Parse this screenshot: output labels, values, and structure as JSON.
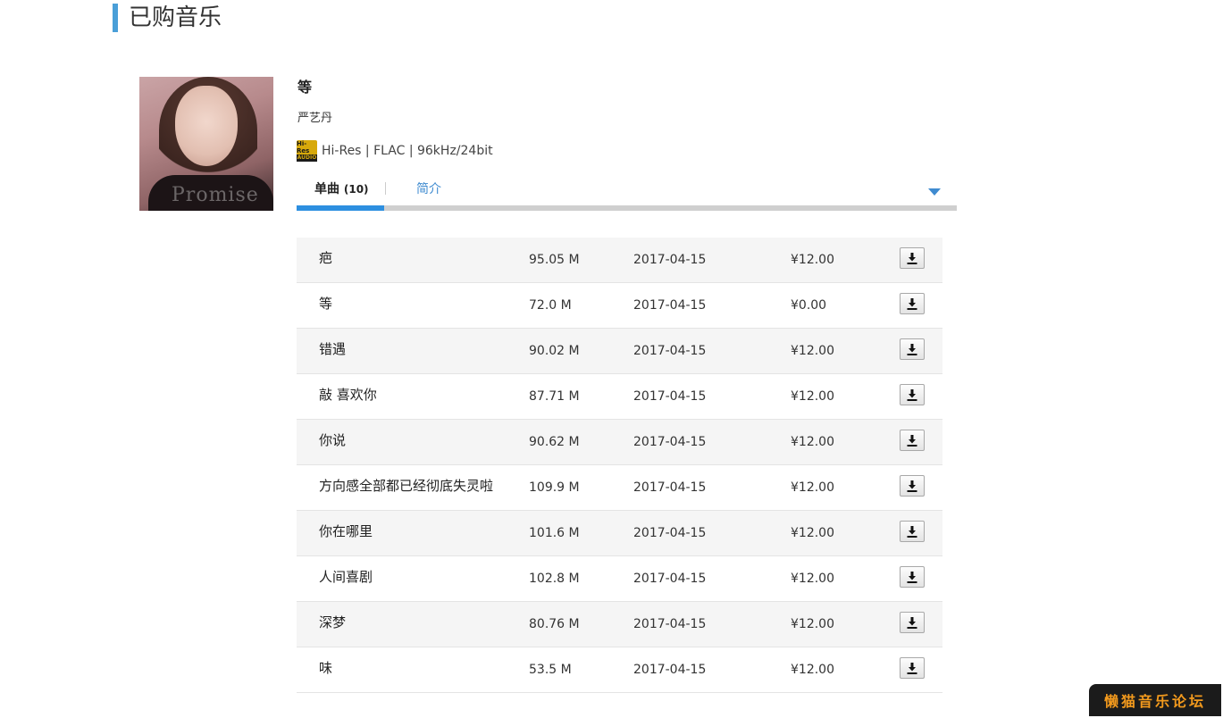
{
  "page": {
    "title": "已购音乐"
  },
  "album": {
    "cover_text": "Promise",
    "title": "等",
    "artist": "严艺丹",
    "hires_badge": {
      "top": "Hi-Res",
      "bottom": "AUDIO"
    },
    "quality": "Hi-Res | FLAC | 96kHz/24bit"
  },
  "tabs": {
    "songs_label": "单曲",
    "songs_count": "(10)",
    "intro_label": "简介",
    "active": "songs"
  },
  "colors": {
    "accent": "#2d8fe0",
    "title_bar": "#4a9fd8",
    "link": "#3f8bd0",
    "watermark": "#f39a1d"
  },
  "tracks": [
    {
      "name": "疤",
      "size": "95.05 M",
      "date": "2017-04-15",
      "price": "¥12.00"
    },
    {
      "name": "等",
      "size": "72.0 M",
      "date": "2017-04-15",
      "price": "¥0.00"
    },
    {
      "name": "错遇",
      "size": "90.02 M",
      "date": "2017-04-15",
      "price": "¥12.00"
    },
    {
      "name": "敲 喜欢你",
      "size": "87.71 M",
      "date": "2017-04-15",
      "price": "¥12.00"
    },
    {
      "name": "你说",
      "size": "90.62 M",
      "date": "2017-04-15",
      "price": "¥12.00"
    },
    {
      "name": "方向感全部都已经彻底失灵啦",
      "size": "109.9 M",
      "date": "2017-04-15",
      "price": "¥12.00"
    },
    {
      "name": "你在哪里",
      "size": "101.6 M",
      "date": "2017-04-15",
      "price": "¥12.00"
    },
    {
      "name": "人间喜剧",
      "size": "102.8 M",
      "date": "2017-04-15",
      "price": "¥12.00"
    },
    {
      "name": "深梦",
      "size": "80.76 M",
      "date": "2017-04-15",
      "price": "¥12.00"
    },
    {
      "name": "味",
      "size": "53.5 M",
      "date": "2017-04-15",
      "price": "¥12.00"
    }
  ],
  "icons": {
    "download": "download-icon",
    "expand": "chevron-down-icon"
  },
  "watermark": "懒猫音乐论坛"
}
